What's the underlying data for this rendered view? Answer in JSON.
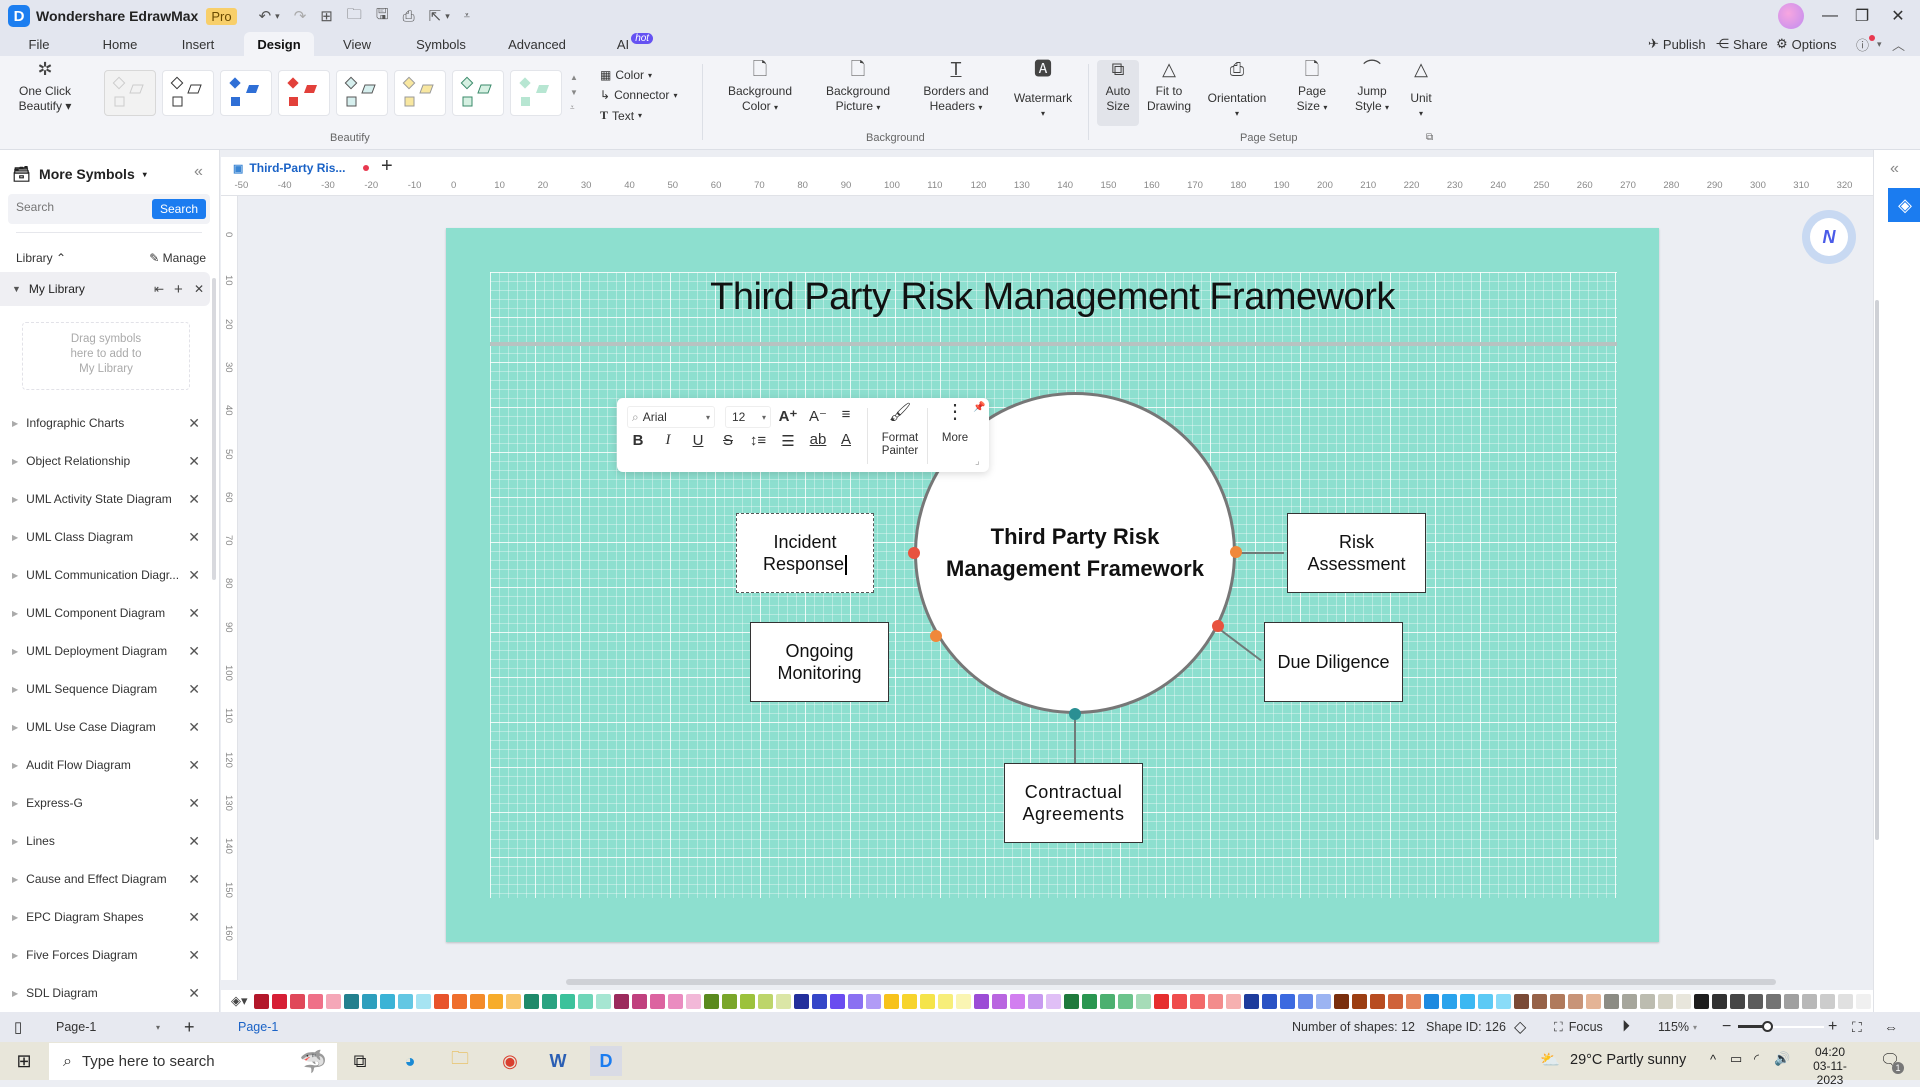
{
  "app": {
    "name": "Wondershare EdrawMax",
    "badge": "Pro",
    "brand_color": "#1b7cf0"
  },
  "menu": {
    "tabs": [
      {
        "label": "File"
      },
      {
        "label": "Home"
      },
      {
        "label": "Insert"
      },
      {
        "label": "Design",
        "active": true
      },
      {
        "label": "View"
      },
      {
        "label": "Symbols"
      },
      {
        "label": "Advanced"
      },
      {
        "label": "AI",
        "badge": "hot"
      }
    ],
    "right_actions": {
      "publish": "Publish",
      "share": "Share",
      "options": "Options"
    }
  },
  "ribbon": {
    "one_click_beautify": "One Click\nBeautify",
    "one_click_line1": "One Click",
    "one_click_line2": "Beautify",
    "small_buttons": {
      "color": "Color",
      "connector": "Connector",
      "text": "Text"
    },
    "background_buttons": [
      {
        "l1": "Background",
        "l2": "Color",
        "icon": "bg-color-icon"
      },
      {
        "l1": "Background",
        "l2": "Picture",
        "icon": "bg-picture-icon"
      },
      {
        "l1": "Borders and",
        "l2": "Headers",
        "icon": "borders-icon"
      },
      {
        "l1": "Watermark",
        "l2": "",
        "icon": "watermark-icon"
      }
    ],
    "page_setup_buttons": [
      {
        "l1": "Auto",
        "l2": "Size",
        "icon": "auto-size-icon",
        "active": true
      },
      {
        "l1": "Fit to",
        "l2": "Drawing",
        "icon": "fit-drawing-icon"
      },
      {
        "l1": "Orientation",
        "l2": "",
        "icon": "orientation-icon"
      },
      {
        "l1": "Page",
        "l2": "Size",
        "icon": "page-size-icon"
      },
      {
        "l1": "Jump",
        "l2": "Style",
        "icon": "jump-style-icon"
      },
      {
        "l1": "Unit",
        "l2": "",
        "icon": "unit-icon"
      }
    ],
    "groups": {
      "beautify": "Beautify",
      "background": "Background",
      "page_setup": "Page Setup"
    }
  },
  "sidebar": {
    "title": "More Symbols",
    "search_placeholder": "Search",
    "search_button": "Search",
    "library_label": "Library",
    "manage_label": "Manage",
    "my_library": "My Library",
    "drop_hint_l1": "Drag symbols",
    "drop_hint_l2": "here to add to",
    "drop_hint_l3": "My Library",
    "items": [
      "Infographic Charts",
      "Object Relationship",
      "UML Activity State Diagram",
      "UML Class Diagram",
      "UML Communication Diagr...",
      "UML Component Diagram",
      "UML Deployment Diagram",
      "UML Sequence Diagram",
      "UML Use Case Diagram",
      "Audit Flow Diagram",
      "Express-G",
      "Lines",
      "Cause and Effect Diagram",
      "EPC Diagram Shapes",
      "Five Forces Diagram",
      "SDL Diagram"
    ]
  },
  "document": {
    "tab_label": "Third-Party Ris...",
    "unsaved_dot_color": "#e8384f",
    "h_ruler": [
      "-50",
      "-40",
      "-30",
      "-20",
      "-10",
      "0",
      "10",
      "20",
      "30",
      "40",
      "50",
      "60",
      "70",
      "80",
      "90",
      "100",
      "110",
      "120",
      "130",
      "140",
      "150",
      "160",
      "170",
      "180",
      "190",
      "200",
      "210",
      "220",
      "230",
      "240",
      "250",
      "260",
      "270",
      "280",
      "290",
      "300",
      "310",
      "320"
    ],
    "v_ruler": [
      "0",
      "10",
      "20",
      "30",
      "40",
      "50",
      "60",
      "70",
      "80",
      "90",
      "100",
      "110",
      "120",
      "130",
      "140",
      "150",
      "160"
    ]
  },
  "diagram": {
    "page_color": "#8ddfcf",
    "title": "Third Party Risk Management Framework",
    "center_l1": "Third Party Risk",
    "center_l2": "Management Framework",
    "nodes": {
      "incident_l1": "Incident",
      "incident_l2": "Response",
      "risk_l1": "Risk",
      "risk_l2": "Assessment",
      "ongoing_l1": "Ongoing",
      "ongoing_l2": "Monitoring",
      "due": "Due Diligence",
      "contract_l1": "Contractual",
      "contract_l2": "Agreements"
    },
    "dot_colors": {
      "red": "#e8533f",
      "orange": "#f0883a",
      "teal": "#2a8f93"
    }
  },
  "float_toolbar": {
    "font": "Arial",
    "size": "12",
    "format_painter_l1": "Format",
    "format_painter_l2": "Painter",
    "more": "More"
  },
  "palette": [
    "#b3172a",
    "#d61f35",
    "#e0485a",
    "#ef7088",
    "#f5a7b8",
    "#23808e",
    "#2e9fbd",
    "#3bb3d6",
    "#63c7e3",
    "#a6e4f2",
    "#e8532b",
    "#ef6e2c",
    "#f38b2a",
    "#f7ac2a",
    "#f9c66b",
    "#1f8a6a",
    "#2aa381",
    "#3cc29b",
    "#6fd6b8",
    "#a6e6d2",
    "#9c2a5c",
    "#c0407e",
    "#dc63a0",
    "#ea8cc0",
    "#f2b8d8",
    "#5a8a1e",
    "#7aa62a",
    "#9cc23c",
    "#bdd56a",
    "#dbe6a6",
    "#232f9c",
    "#3546c8",
    "#6a4cf0",
    "#8a70f2",
    "#b19bf6",
    "#f7c21b",
    "#f7d42c",
    "#f5e44a",
    "#f7ee7a",
    "#faf5b3",
    "#9c4cd6",
    "#b965e0",
    "#d27ef0",
    "#c89af0",
    "#e0bff6",
    "#1f7a3c",
    "#2a9650",
    "#4cb070",
    "#6cc48c",
    "#a6dcb8",
    "#e62e2e",
    "#ef4c4c",
    "#f26a6a",
    "#f38c8c",
    "#f6b0b0",
    "#1e3c9c",
    "#2a52c4",
    "#3c6ae0",
    "#6a8cea",
    "#9cb4f2",
    "#7a2e0c",
    "#9c3e12",
    "#b84c20",
    "#cf623a",
    "#e4845c",
    "#1e8ae0",
    "#2aa3ec",
    "#3cb8f2",
    "#5ccaf5",
    "#8adcf8",
    "#7a4a36",
    "#966248",
    "#b07a5c",
    "#c89478",
    "#e4b496",
    "#8c8c84",
    "#a6a69c",
    "#bcbcb0",
    "#d4d2c4",
    "#e8e6dc",
    "#1e1e1e",
    "#323232",
    "#464646",
    "#5c5c5c",
    "#747474",
    "#a0a0a0",
    "#b8b8b8",
    "#cccccc",
    "#e0e0e0",
    "#f0f0f0"
  ],
  "status": {
    "page_select": "Page-1",
    "page_tab": "Page-1",
    "shapes": "Number of shapes: 12",
    "shape_id": "Shape ID: 126",
    "focus": "Focus",
    "zoom": "115%",
    "zoom_fraction": 0.35
  },
  "taskbar": {
    "search_placeholder": "Type here to search",
    "weather": "29°C  Partly sunny",
    "time": "04:20",
    "date": "03-11-2023",
    "notif_count": "1"
  }
}
